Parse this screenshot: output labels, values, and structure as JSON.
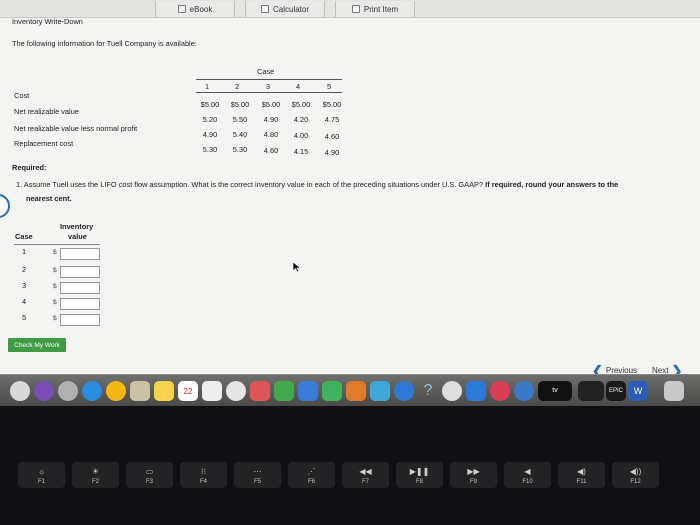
{
  "toolbar": {
    "ebook_label": "eBook",
    "calculator_label": "Calculator",
    "print_label": "Print Item"
  },
  "page": {
    "title": "Inventory Write-Down",
    "intro": "The following information for Tuell Company is available:"
  },
  "case_table": {
    "group_header": "Case",
    "columns": [
      "1",
      "2",
      "3",
      "4",
      "5"
    ],
    "rows": [
      {
        "label": "Cost",
        "values": [
          "$5.00",
          "$5.00",
          "$5.00",
          "$5.00",
          "$5.00"
        ]
      },
      {
        "label": "Net realizable value",
        "values": [
          "5.20",
          "5.50",
          "4.90",
          "4.20",
          "4.75"
        ]
      },
      {
        "label": "Net realizable value less normal profit",
        "values": [
          "4.90",
          "5.40",
          "4.80",
          "4.00",
          "4.60"
        ]
      },
      {
        "label": "Replacement cost",
        "values": [
          "5.30",
          "5.30",
          "4.60",
          "4.15",
          "4.90"
        ]
      }
    ]
  },
  "required": {
    "heading": "Required:",
    "question_a": "1. Assume Tuell uses the LIFO cost flow assumption. What is the correct inventory value in each of the preceding situations under U.S. GAAP?",
    "question_b": "If required, round your answers to the",
    "question_c": "nearest cent."
  },
  "answer_table": {
    "case_header": "Case",
    "value_header_1": "Inventory",
    "value_header_2": "value",
    "currency": "$",
    "rows": [
      {
        "case": "1",
        "value": ""
      },
      {
        "case": "2",
        "value": ""
      },
      {
        "case": "3",
        "value": ""
      },
      {
        "case": "4",
        "value": ""
      },
      {
        "case": "5",
        "value": ""
      }
    ]
  },
  "footer": {
    "check_label": "Check My Work",
    "previous_label": "Previous",
    "next_label": "Next"
  },
  "dock": {
    "calendar_day": "22",
    "tv_label": "tv",
    "epic_label": "EPIC",
    "word_label": "W"
  },
  "keyboard": {
    "keys": [
      "F1",
      "F2",
      "F3",
      "F4",
      "F5",
      "F6",
      "F7",
      "F8",
      "F9",
      "F10",
      "F11",
      "F12"
    ]
  },
  "colors": {
    "accent": "#2a6bb5",
    "check_button": "#3f9b46",
    "screen_bg": "#f4f4f2"
  }
}
